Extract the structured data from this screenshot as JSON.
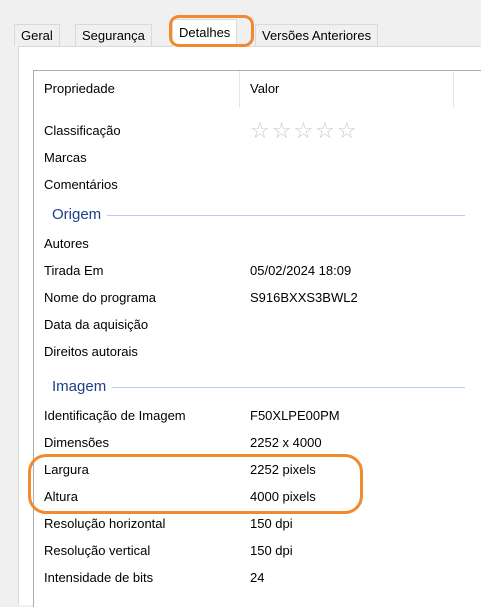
{
  "tabs": [
    {
      "label": "Geral"
    },
    {
      "label": "Segurança"
    },
    {
      "label": "Detalhes"
    },
    {
      "label": "Versões Anteriores"
    }
  ],
  "columns": {
    "property": "Propriedade",
    "value": "Valor"
  },
  "rows_top": [
    {
      "name": "Classificação",
      "value": ""
    },
    {
      "name": "Marcas",
      "value": ""
    },
    {
      "name": "Comentários",
      "value": ""
    }
  ],
  "rating": {
    "stars": "☆☆☆☆☆",
    "filled": 0,
    "max": 5
  },
  "sections": {
    "origem": {
      "title": "Origem",
      "rows": [
        {
          "name": "Autores",
          "value": ""
        },
        {
          "name": "Tirada Em",
          "value": "05/02/2024 18:09"
        },
        {
          "name": "Nome do programa",
          "value": "S916BXXS3BWL2"
        },
        {
          "name": "Data da aquisição",
          "value": ""
        },
        {
          "name": "Direitos autorais",
          "value": ""
        }
      ]
    },
    "imagem": {
      "title": "Imagem",
      "rows": [
        {
          "name": "Identificação de Imagem",
          "value": "F50XLPE00PM"
        },
        {
          "name": "Dimensões",
          "value": "2252 x 4000"
        },
        {
          "name": "Largura",
          "value": "2252 pixels"
        },
        {
          "name": "Altura",
          "value": "4000 pixels"
        },
        {
          "name": "Resolução horizontal",
          "value": "150 dpi"
        },
        {
          "name": "Resolução vertical",
          "value": "150 dpi"
        },
        {
          "name": "Intensidade de bits",
          "value": "24"
        }
      ]
    }
  },
  "colors": {
    "highlight": "#f08a2e",
    "section_title": "#1e3f8a"
  }
}
